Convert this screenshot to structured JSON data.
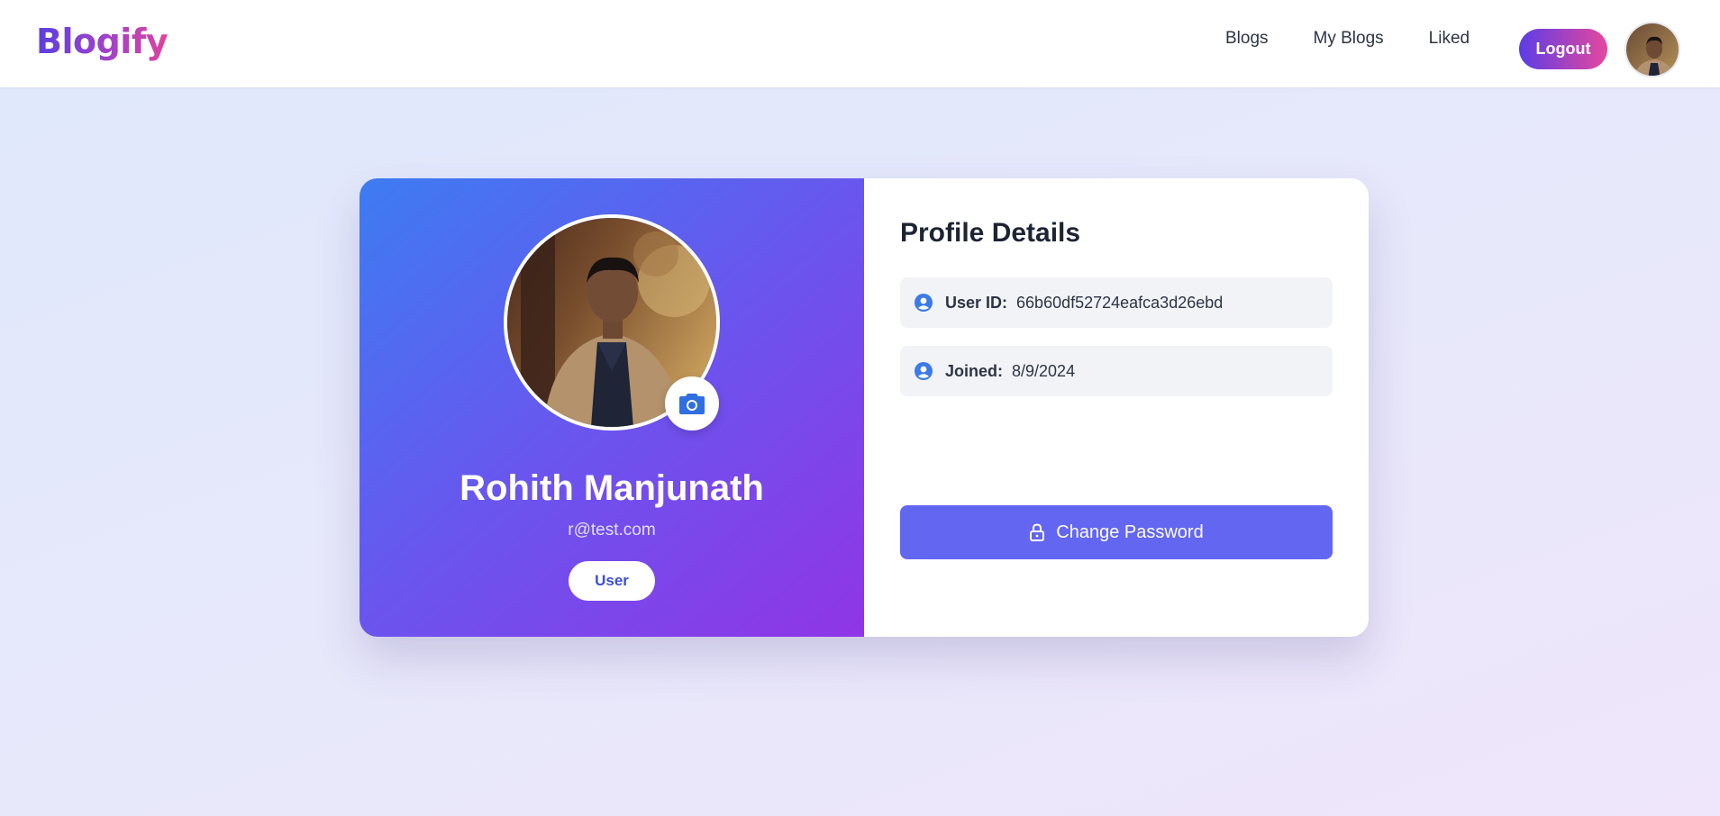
{
  "brand": {
    "name": "Blogify"
  },
  "nav": {
    "links": [
      "Blogs",
      "My Blogs",
      "Liked"
    ],
    "logout_label": "Logout"
  },
  "profile": {
    "name": "Rohith Manjunath",
    "email": "r@test.com",
    "role": "User"
  },
  "details": {
    "title": "Profile Details",
    "user_id_label": "User ID:",
    "user_id_value": "66b60df52724eafca3d26ebd",
    "joined_label": "Joined:",
    "joined_value": "8/9/2024",
    "change_password_label": "Change Password"
  },
  "colors": {
    "accent": "#6366f1",
    "gradient_start": "#3d7cf2",
    "gradient_end": "#9035e6",
    "icon_blue": "#3b7ae8"
  },
  "icons": {
    "camera": "camera-icon",
    "user_circle": "user-circle-icon",
    "lock": "lock-icon"
  }
}
